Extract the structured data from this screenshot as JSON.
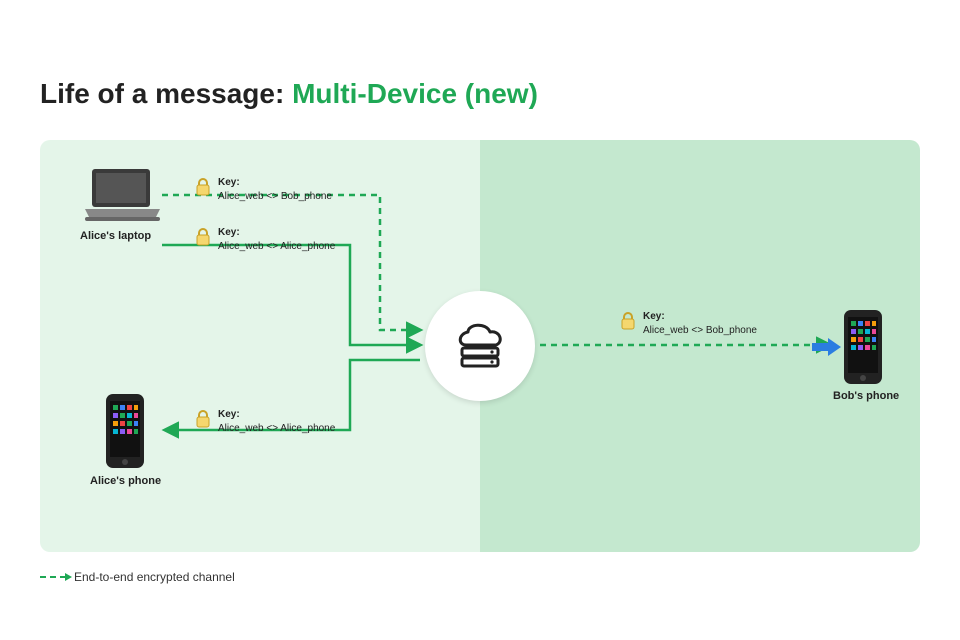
{
  "title_prefix": "Life of a message: ",
  "title_accent": "Multi-Device (new)",
  "devices": {
    "alice_laptop": "Alice's laptop",
    "alice_phone": "Alice's phone",
    "bob_phone": "Bob's phone"
  },
  "keys": {
    "laptop_to_bob": {
      "label": "Key:",
      "value": "Alice_web <> Bob_phone"
    },
    "laptop_to_alice_phone": {
      "label": "Key:",
      "value": "Alice_web <> Alice_phone"
    },
    "server_to_alice_phone": {
      "label": "Key:",
      "value": "Alice_web <> Alice_phone"
    },
    "server_to_bob": {
      "label": "Key:",
      "value": "Alice_web <> Bob_phone"
    }
  },
  "legend": "End-to-end encrypted channel",
  "colors": {
    "accent": "#1fa855",
    "panel_left": "#e4f5e9",
    "panel_right": "#c4e8cf"
  }
}
